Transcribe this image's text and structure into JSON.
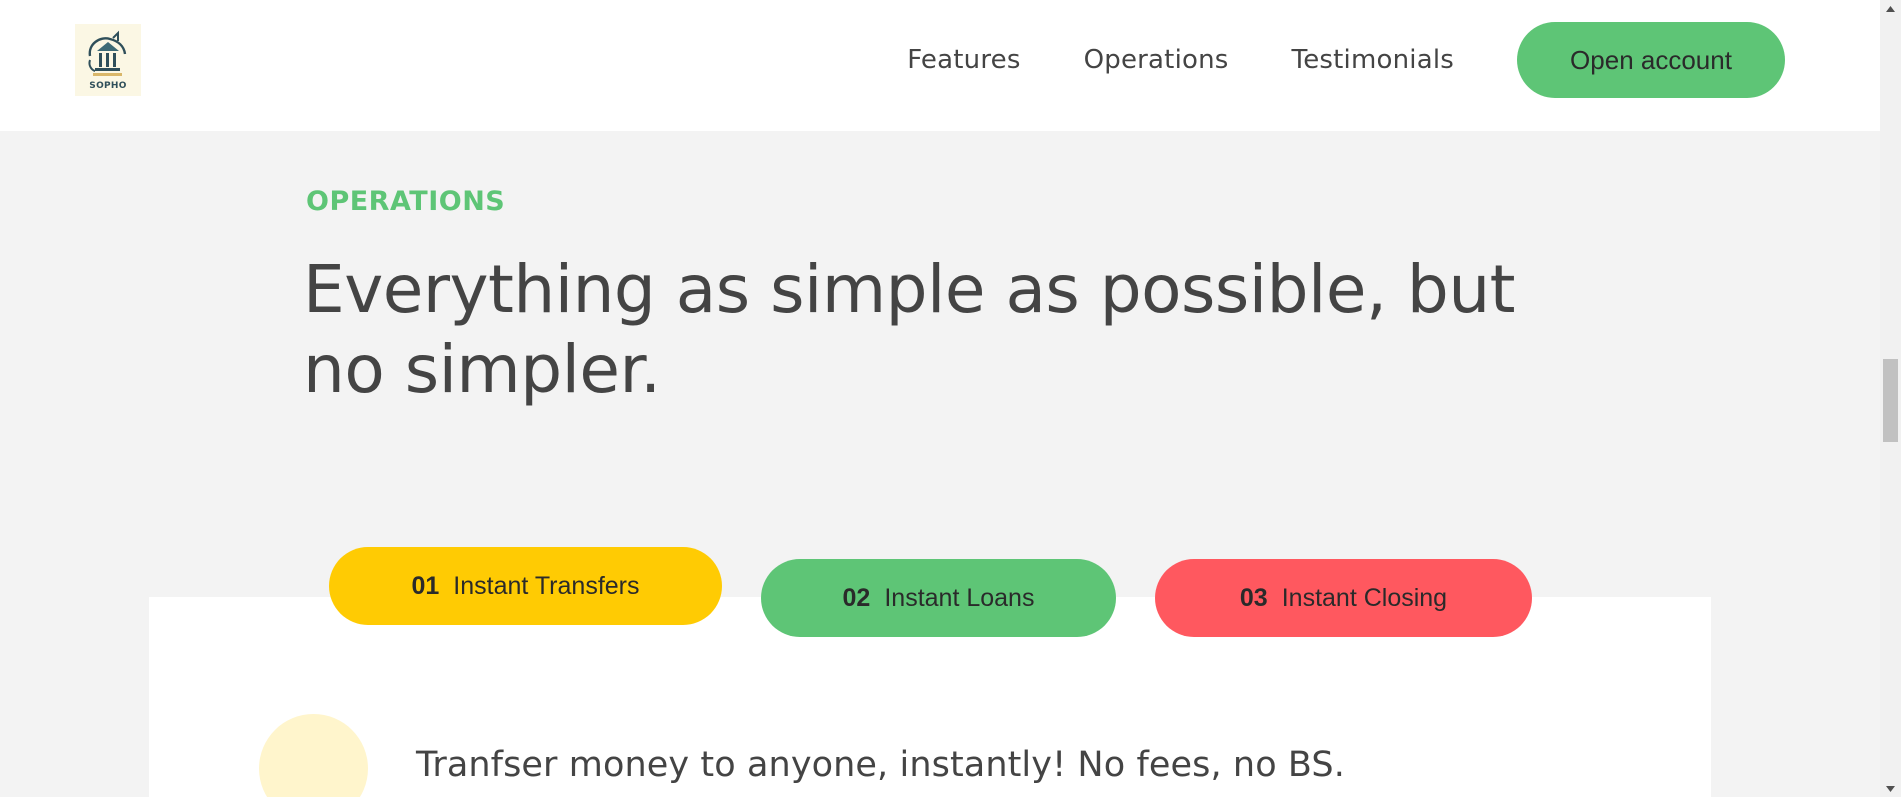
{
  "header": {
    "logo": {
      "text": "SOPHO",
      "icon": "bank-piggy-icon"
    },
    "nav": [
      {
        "label": "Features"
      },
      {
        "label": "Operations"
      },
      {
        "label": "Testimonials"
      }
    ],
    "cta_label": "Open account"
  },
  "section": {
    "label": "OPERATIONS",
    "heading": "Everything as simple as possible, but no simpler."
  },
  "tabs": [
    {
      "num": "01",
      "label": "Instant Transfers",
      "color": "#ffcb03",
      "active": true
    },
    {
      "num": "02",
      "label": "Instant Loans",
      "color": "#5ec576",
      "active": false
    },
    {
      "num": "03",
      "label": "Instant Closing",
      "color": "#ff585f",
      "active": false
    }
  ],
  "content": {
    "heading": "Tranfser money to anyone, instantly! No fees, no BS.",
    "icon_bg": "#fff5cc"
  },
  "colors": {
    "accent_green": "#5ec576",
    "section_bg": "#f3f3f3",
    "text": "#444444"
  }
}
